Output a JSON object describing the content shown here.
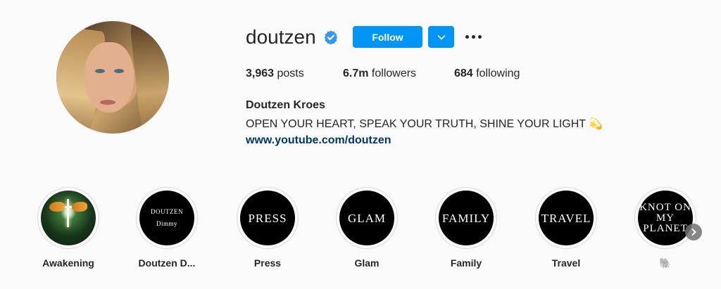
{
  "profile": {
    "username": "doutzen",
    "follow_label": "Follow",
    "stats": [
      {
        "value": "3,963",
        "label": "posts"
      },
      {
        "value": "6.7m",
        "label": "followers"
      },
      {
        "value": "684",
        "label": "following"
      }
    ],
    "full_name": "Doutzen Kroes",
    "bio": "OPEN YOUR HEART, SPEAK YOUR TRUTH, SHINE YOUR LIGHT",
    "bio_emoji": "💫",
    "link": "www.youtube.com/doutzen"
  },
  "highlights": [
    {
      "label": "Awakening",
      "cover": ""
    },
    {
      "label": "Doutzen D...",
      "cover": "DOUTZEN Dimmy"
    },
    {
      "label": "Press",
      "cover": "PRESS"
    },
    {
      "label": "Glam",
      "cover": "GLAM"
    },
    {
      "label": "Family",
      "cover": "FAMILY"
    },
    {
      "label": "Travel",
      "cover": "TRAVEL"
    },
    {
      "label": "🐘",
      "cover": "KNOT ON MY PLANET"
    }
  ],
  "colors": {
    "accent": "#0095f6",
    "link": "#00376b",
    "text": "#262626"
  }
}
